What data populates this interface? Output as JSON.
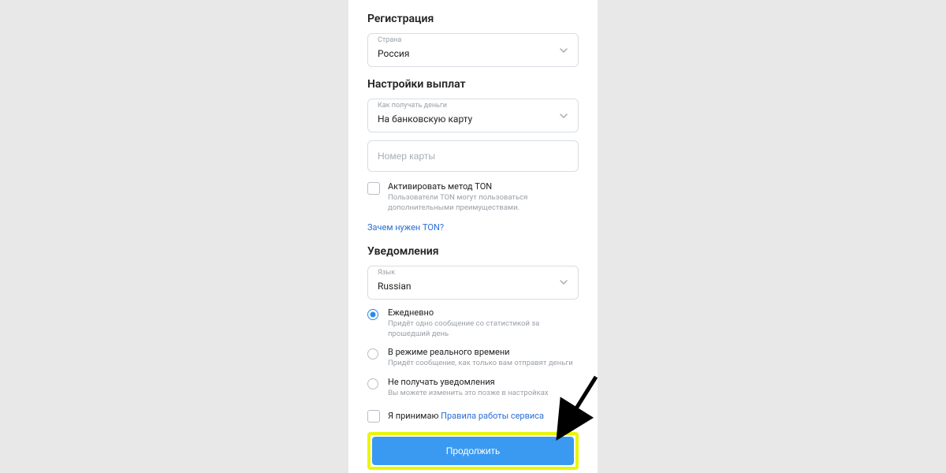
{
  "registration": {
    "title": "Регистрация",
    "country": {
      "label": "Страна",
      "value": "Россия"
    }
  },
  "payout": {
    "title": "Настройки выплат",
    "method": {
      "label": "Как получать деньги",
      "value": "На банковскую карту"
    },
    "card_placeholder": "Номер карты",
    "ton": {
      "title": "Активировать метод TON",
      "desc": "Пользователи TON могут пользоваться дополнительными преимуществами."
    },
    "ton_link": "Зачем нужен TON?"
  },
  "notifications": {
    "title": "Уведомления",
    "language": {
      "label": "Язык",
      "value": "Russian"
    },
    "options": [
      {
        "title": "Ежедневно",
        "desc": "Придёт одно сообщение со статистикой за прошедший день",
        "checked": true
      },
      {
        "title": "В режиме реального времени",
        "desc": "Придёт сообщение, как только вам отправят деньги",
        "checked": false
      },
      {
        "title": "Не получать уведомления",
        "desc": "Вы можете изменить это позже в настройках",
        "checked": false
      }
    ]
  },
  "terms": {
    "prefix": "Я принимаю ",
    "link": "Правила работы сервиса"
  },
  "submit_label": "Продолжить"
}
